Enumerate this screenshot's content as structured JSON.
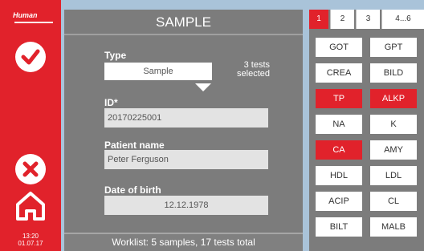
{
  "sidebar": {
    "logo_text": "Human",
    "confirm_icon": "check-icon",
    "cancel_icon": "close-icon",
    "home_icon": "home-icon",
    "time": "13:20",
    "date": "01.07.17"
  },
  "main": {
    "title": "SAMPLE",
    "type_label": "Type",
    "type_value": "Sample",
    "tests_selected_line1": "3 tests",
    "tests_selected_line2": "selected",
    "id_label": "ID*",
    "id_value": "20170225001",
    "patient_label": "Patient name",
    "patient_value": "Peter Ferguson",
    "dob_label": "Date of birth",
    "dob_value": "12.12.1978"
  },
  "footer": {
    "worklist_text": "Worklist: 5 samples, 17 tests total"
  },
  "panel": {
    "tabs": [
      "1",
      "2",
      "3",
      "4...6"
    ],
    "active_tab": "1",
    "tests": [
      {
        "label": "GOT",
        "selected": false
      },
      {
        "label": "GPT",
        "selected": false
      },
      {
        "label": "CREA",
        "selected": false
      },
      {
        "label": "BILD",
        "selected": false
      },
      {
        "label": "TP",
        "selected": true
      },
      {
        "label": "ALKP",
        "selected": true
      },
      {
        "label": "NA",
        "selected": false
      },
      {
        "label": "K",
        "selected": false
      },
      {
        "label": "CA",
        "selected": true
      },
      {
        "label": "AMY",
        "selected": false
      },
      {
        "label": "HDL",
        "selected": false
      },
      {
        "label": "LDL",
        "selected": false
      },
      {
        "label": "ACIP",
        "selected": false
      },
      {
        "label": "CL",
        "selected": false
      },
      {
        "label": "BILT",
        "selected": false
      },
      {
        "label": "MALB",
        "selected": false
      }
    ]
  },
  "colors": {
    "accent_red": "#e1222b",
    "panel_gray": "#7c7c7c",
    "background_blue": "#a9c3d9"
  }
}
